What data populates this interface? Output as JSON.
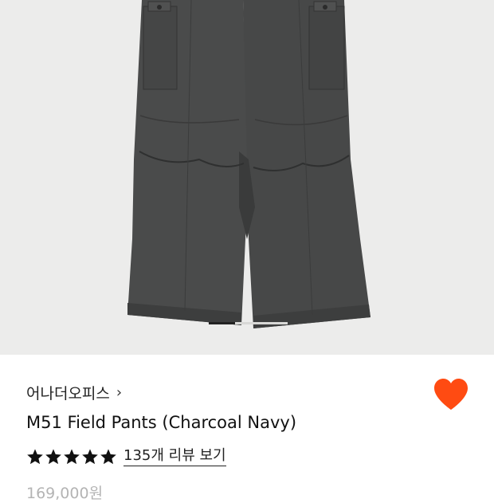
{
  "product_image": {
    "alt": "M51 Field Pants (Charcoal Navy)",
    "carousel_total": 3,
    "carousel_active": 1
  },
  "brand": {
    "name": "어나더오피스",
    "chevron": "›"
  },
  "wishlist": {
    "icon": "heart-icon",
    "color": "#ff4b12",
    "active": true
  },
  "product": {
    "title": "M51 Field Pants (Charcoal Navy)",
    "rating_stars": 5,
    "reviews_label": "135개 리뷰 보기",
    "price": "169,000원"
  }
}
